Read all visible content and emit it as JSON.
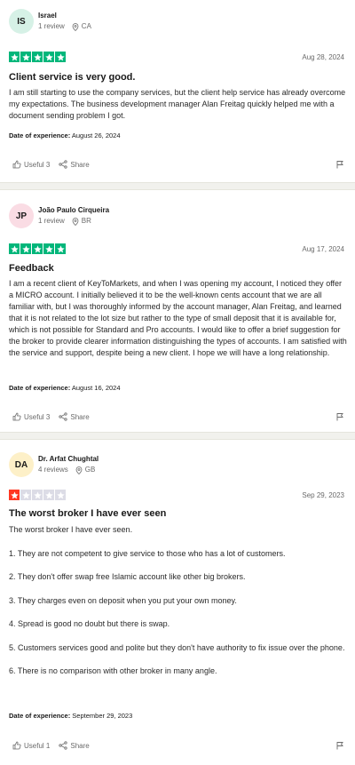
{
  "reviews": [
    {
      "initials": "IS",
      "avatar_color": "#d6f1e6",
      "name": "Israel",
      "review_count": "1 review",
      "country": "CA",
      "rating": 5,
      "star_color": "#00b67a",
      "date": "Aug 28, 2024",
      "title": "Client service is very good.",
      "paragraphs": [
        "I am still starting to use the company services, but the client help service has already overcome my expectations. The business development manager Alan Freitag quickly helped me with a document sending problem I got."
      ],
      "experience_label": "Date of experience:",
      "experience_date": "August 26, 2024",
      "useful": "Useful 3",
      "share": "Share"
    },
    {
      "initials": "JP",
      "avatar_color": "#fadce4",
      "name": "João Paulo Cirqueira",
      "review_count": "1 review",
      "country": "BR",
      "rating": 5,
      "star_color": "#00b67a",
      "date": "Aug 17, 2024",
      "title": "Feedback",
      "paragraphs": [
        "I am a recent client of KeyToMarkets, and when I was opening my account, I noticed they offer a MICRO account. I initially believed it to be the well-known cents account that we are all familiar with, but I was thoroughly informed by the account manager, Alan Freitag, and learned that it is not related to the lot size but rather to the type of small deposit that it is available for, which is not possible for Standard and Pro accounts. I would like to offer a brief suggestion for the broker to provide clearer information distinguishing the types of accounts. I am satisfied with the service and support, despite being a new client. I hope we will have a long relationship."
      ],
      "experience_label": "Date of experience:",
      "experience_date": "August 16, 2024",
      "useful": "Useful 3",
      "share": "Share"
    },
    {
      "initials": "DA",
      "avatar_color": "#fdf0c8",
      "name": "Dr. Arfat Chughtal",
      "review_count": "4 reviews",
      "country": "GB",
      "rating": 1,
      "star_color": "#ff3722",
      "date": "Sep 29, 2023",
      "title": "The worst broker I have ever seen",
      "paragraphs": [
        "The worst broker I have ever seen.",
        "",
        "1. They are not competent to give service to those who has a lot of customers.",
        "2. They don't offer swap free Islamic account like other big brokers.",
        "3. They charges even on deposit when you put your own money.",
        "4. Spread is good no doubt but there is swap.",
        "5. Customers services good and polite but they don't have authority to fix issue over the phone.",
        "6. There is no comparison with other broker in many angle."
      ],
      "experience_label": "Date of experience:",
      "experience_date": "September 29, 2023",
      "useful": "Useful 1",
      "share": "Share"
    }
  ]
}
